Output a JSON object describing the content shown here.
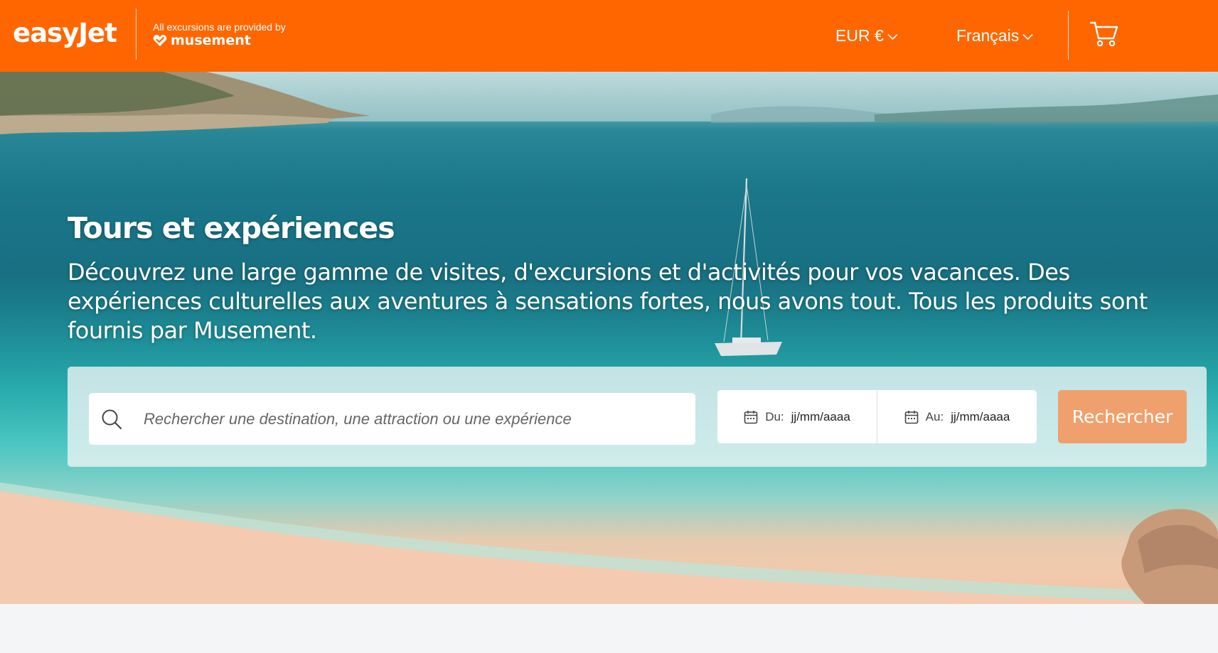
{
  "header": {
    "logo_text": "easyJet",
    "provided_by": "All excursions are provided by",
    "partner_name": "musement",
    "currency_label": "EUR €",
    "language_label": "Français"
  },
  "hero": {
    "title": "Tours et expériences",
    "subtitle": "Découvrez une large gamme de visites, d'excursions et d'activités pour vos vacances. Des expériences culturelles aux aventures à sensations fortes, nous avons tout. Tous les produits sont fournis par Musement."
  },
  "search": {
    "placeholder": "Rechercher une destination, une attraction ou une expérience",
    "value": "",
    "date_from_label": "Du:",
    "date_from_value": "jj/mm/aaaa",
    "date_to_label": "Au:",
    "date_to_value": "jj/mm/aaaa",
    "button_label": "Rechercher"
  },
  "colors": {
    "brand": "#ff6600",
    "button": "#f0a06c"
  },
  "icons": [
    "heart-icon",
    "chevron-down-icon",
    "cart-icon",
    "search-icon",
    "calendar-icon"
  ]
}
